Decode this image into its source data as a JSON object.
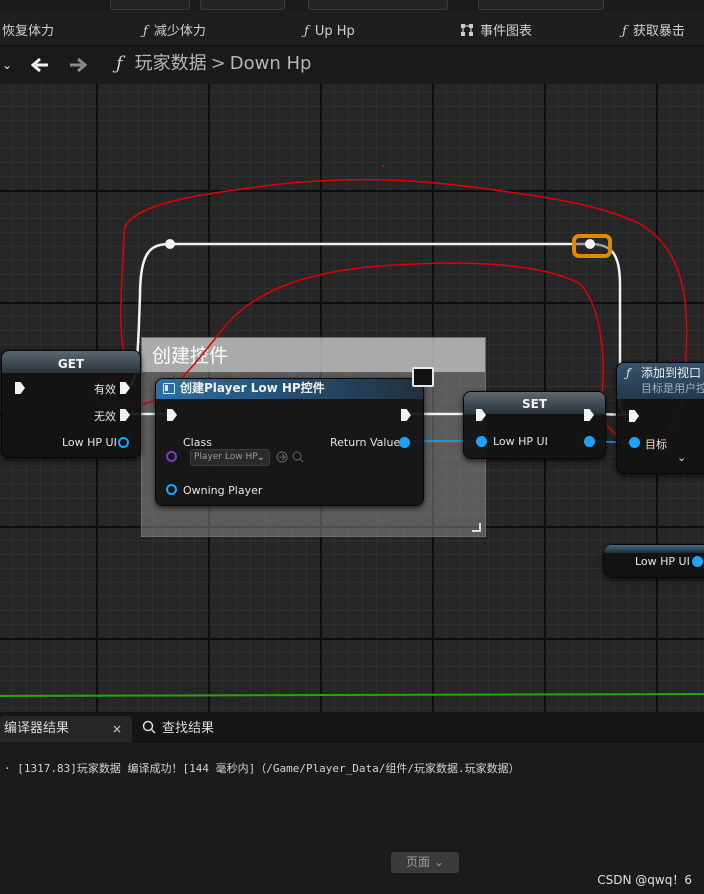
{
  "function_tabs": [
    {
      "label": "恢复体力",
      "icon": ""
    },
    {
      "label": "减少体力",
      "icon": "function-icon"
    },
    {
      "label": "Up Hp",
      "icon": "function-icon"
    },
    {
      "label": "事件图表",
      "icon": "event-graph-icon"
    },
    {
      "label": "获取暴击",
      "icon": "function-icon"
    }
  ],
  "breadcrumb": {
    "blueprint": "玩家数据",
    "separator": ">",
    "function": "Down Hp"
  },
  "graph": {
    "comment_title": "创建控件",
    "get_node": {
      "title": "GET",
      "pin_valid": "有效",
      "pin_invalid": "无效",
      "pin_var": "Low HP UI"
    },
    "create_widget_node": {
      "title": "创建Player Low HP控件",
      "pin_class": "Class",
      "class_value": "Player Low HP",
      "pin_owning_player": "Owning Player",
      "pin_return": "Return Value"
    },
    "set_node": {
      "title": "SET",
      "pin_var": "Low HP UI"
    },
    "add_to_viewport_node": {
      "title": "添加到视口",
      "subtitle": "目标是用户控",
      "pin_target": "目标"
    },
    "var_node": {
      "label": "Low HP UI"
    }
  },
  "bottom_panel": {
    "tabs": [
      {
        "label": "编译器结果",
        "close": "×",
        "active": true
      },
      {
        "label": "查找结果",
        "icon": "search-icon",
        "active": false
      }
    ],
    "log_line": "· [1317.83]玩家数据 编译成功！[144 毫秒内]（/Game/Player_Data/组件/玩家数据.玩家数据）",
    "page_button": "页面"
  },
  "watermark": "CSDN @qwq！6",
  "colors": {
    "exec_wire": "#f2f2f2",
    "object_pin": "#1aa3ff",
    "class_pin": "#7a3bc7",
    "selection": "#e08a00",
    "annotation": "#e00000",
    "green_line": "#2aa012"
  }
}
